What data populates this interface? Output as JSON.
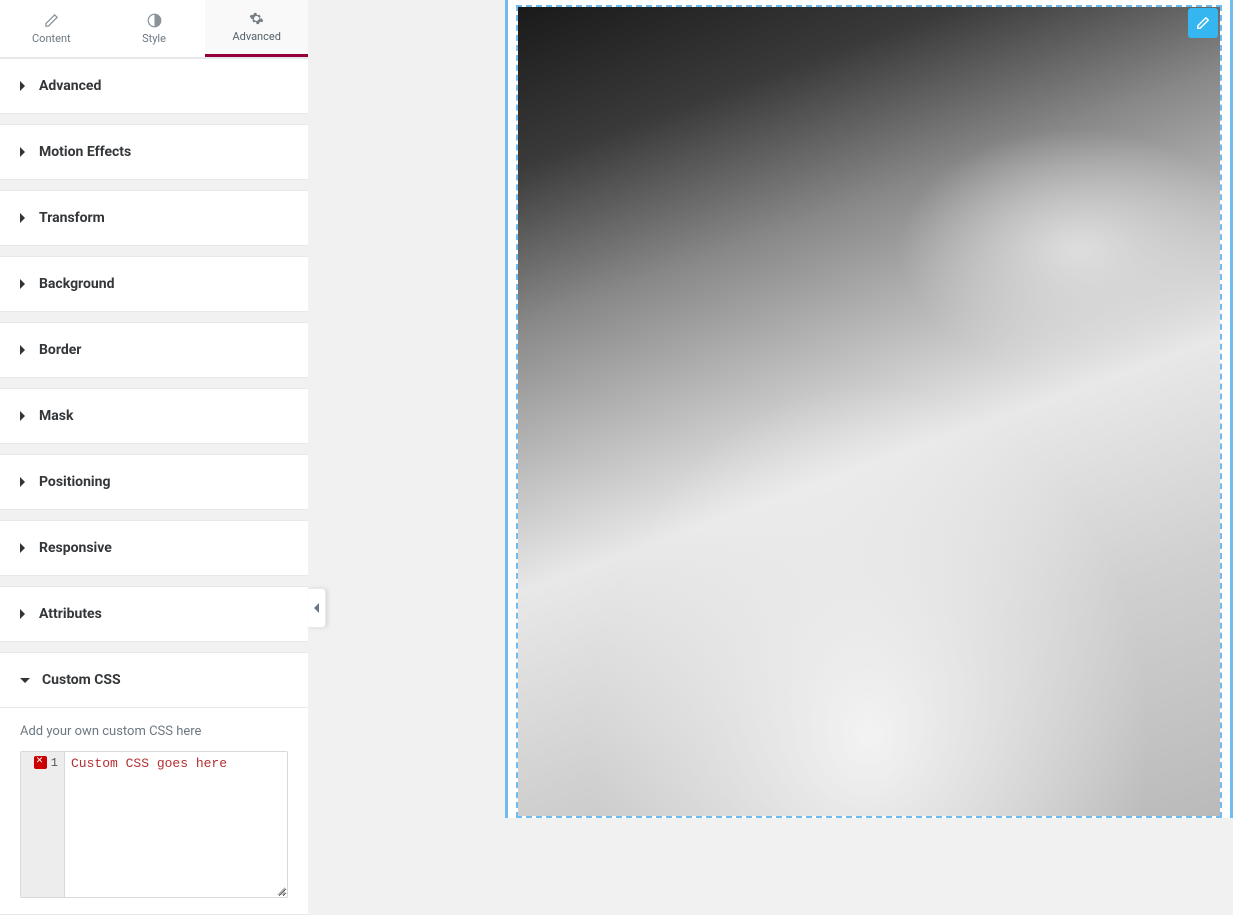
{
  "tabs": {
    "content": "Content",
    "style": "Style",
    "advanced": "Advanced"
  },
  "sections": {
    "advanced": "Advanced",
    "motion_effects": "Motion Effects",
    "transform": "Transform",
    "background": "Background",
    "border": "Border",
    "mask": "Mask",
    "positioning": "Positioning",
    "responsive": "Responsive",
    "attributes": "Attributes",
    "custom_css": "Custom CSS"
  },
  "custom_css": {
    "help_text": "Add your own custom CSS here",
    "line_number": "1",
    "placeholder_text": "Custom CSS goes here"
  }
}
